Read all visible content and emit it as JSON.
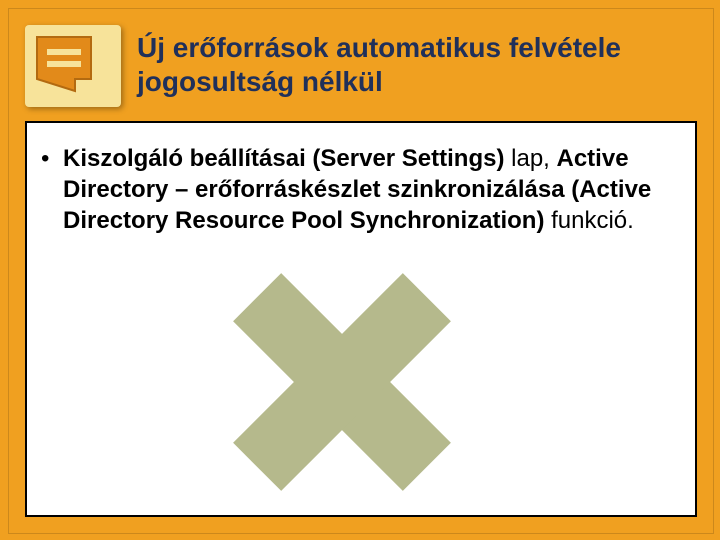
{
  "title": "Új erőforrások automatikus felvétele jogosultság nélkül",
  "bullet": {
    "prefix_bold": "Kiszolgáló beállításai (Server Settings)",
    "mid1": " lap, ",
    "part2_bold": "Active Directory – erőforráskészlet szinkronizálása  (Active Directory Resource Pool Synchronization)",
    "suffix": " funkció."
  }
}
